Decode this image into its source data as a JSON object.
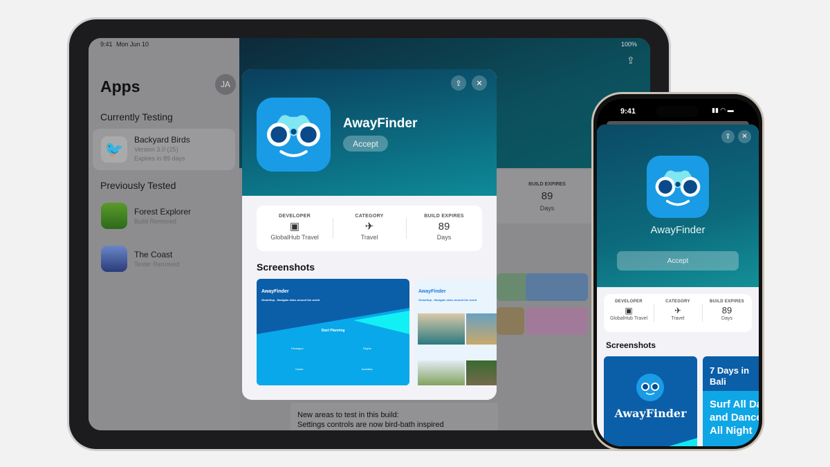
{
  "ipad": {
    "status": {
      "time": "9:41",
      "date": "Mon Jun 10",
      "battery": "100%"
    },
    "sidebar": {
      "title": "Apps",
      "avatar": "JA",
      "currently_testing": "Currently Testing",
      "current": [
        {
          "name": "Backyard Birds",
          "version": "Version 3.0 (25)",
          "expires": "Expires in 89 days"
        }
      ],
      "previously_tested": "Previously Tested",
      "previous": [
        {
          "name": "Forest Explorer",
          "status": "Build Removed"
        },
        {
          "name": "The Coast",
          "status": "Tester Removed"
        }
      ]
    },
    "background": {
      "build_expires_label": "BUILD EXPIRES",
      "build_expires_value": "89",
      "build_expires_unit": "Days",
      "notes_title": "New areas to test in this build:",
      "notes_line": "Settings controls are now bird-bath inspired"
    },
    "modal": {
      "app_name": "AwayFinder",
      "accept": "Accept",
      "info": {
        "developer_label": "DEVELOPER",
        "developer": "GlobalHub Travel",
        "category_label": "CATEGORY",
        "category": "Travel",
        "expires_label": "BUILD EXPIRES",
        "expires_value": "89",
        "expires_unit": "Days"
      },
      "screenshots_label": "Screenshots",
      "shot1": {
        "title": "AwayFinder",
        "subtitle": "GlobeHop - Navigate skies around the world",
        "cta": "Start Planning",
        "items": [
          "Packages",
          "Flights",
          "Hotels",
          "Activities"
        ]
      },
      "shot2": {
        "title": "AwayFinder",
        "subtitle": "GlobeHop - Navigate skies around the world"
      }
    }
  },
  "iphone": {
    "status": {
      "time": "9:41"
    },
    "app_name": "AwayFinder",
    "accept": "Accept",
    "info": {
      "developer_label": "DEVELOPER",
      "developer": "GlobalHub Travel",
      "category_label": "CATEGORY",
      "category": "Travel",
      "expires_label": "BUILD EXPIRES",
      "expires_value": "89",
      "expires_unit": "Days"
    },
    "screenshots_label": "Screenshots",
    "shot1": {
      "logo": "AwayFinder"
    },
    "shot2": {
      "line1": "7 Days in",
      "line2": "Bali",
      "line3": "Surf All Day",
      "line4": "and Dance",
      "line5": "All Night"
    }
  },
  "colors": {
    "teal": "#0c6b80",
    "icon_blue": "#1a9be6",
    "shot_blue": "#0b5ea8",
    "cyan": "#16b8f0"
  }
}
